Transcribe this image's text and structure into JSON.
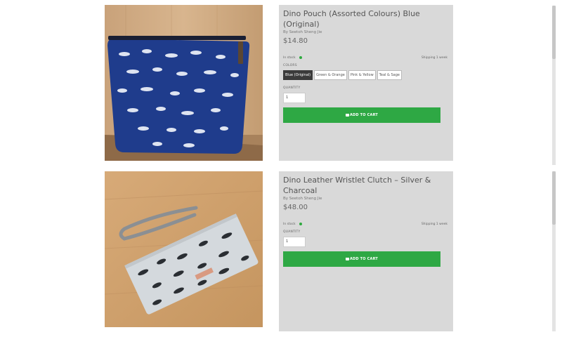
{
  "products": [
    {
      "title": "Dino Pouch (Assorted Colours) Blue (Original)",
      "byline": "By Seetoh Sheng Jie",
      "price": "$14.80",
      "stock": "In stock",
      "shipping": "Shipping 1 week",
      "colors_label": "COLORS",
      "colors": [
        "Blue (Original)",
        "Green & Orange",
        "Pink & Yellow",
        "Teal & Sage"
      ],
      "selected_color": "Blue (Original)",
      "quantity_label": "QUANTITY",
      "quantity": "1",
      "cart_label": "ADD TO CART",
      "image_icon": "dino-pouch-photo"
    },
    {
      "title": "Dino Leather Wristlet Clutch – Silver & Charcoal",
      "byline": "By Seetoh Sheng Jie",
      "price": "$48.00",
      "stock": "In stock",
      "shipping": "Shipping 1 week",
      "quantity_label": "QUANTITY",
      "quantity": "1",
      "cart_label": "ADD TO CART",
      "image_icon": "dino-clutch-photo"
    }
  ],
  "colors": {
    "accent": "#2ea844",
    "panel": "#d9d9d9",
    "stock_dot": "#2eaa3f",
    "chip_active": "#3b3b3b"
  }
}
